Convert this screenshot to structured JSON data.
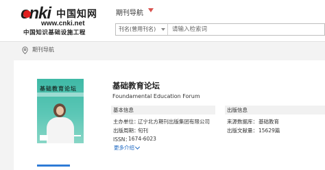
{
  "logo": {
    "brand": "cnki",
    "name_cn": "中国知网",
    "url": "www.cnki.net",
    "slogan": "中国知识基础设施工程"
  },
  "nav": {
    "title": "期刊导航"
  },
  "search": {
    "field_selected": "刊名(曾用刊名)",
    "placeholder": "请输入检索词"
  },
  "breadcrumb": {
    "label": "期刊导航"
  },
  "journal": {
    "cover_title": "基础教育论坛",
    "title": "基础教育论坛",
    "title_en": "Foundamental Education Forum",
    "basic_info": {
      "heading": "基本信息",
      "sponsor_label": "主办单位：",
      "sponsor": "辽宁北方期刊出版集团有限公司",
      "cycle_label": "出版周期：",
      "cycle": "旬刊",
      "issn_label": "ISSN：",
      "issn": "1674-6023"
    },
    "publish_info": {
      "heading": "出版信息",
      "database_label": "来源数据库：",
      "database": "基础教育",
      "count_label": "出版文献量：",
      "count": "15629篇"
    },
    "more_label": "更多介绍"
  },
  "colors": {
    "accent_red": "#d9534f",
    "link_blue": "#1a66c2",
    "cover_teal": "#3fb9a6"
  }
}
